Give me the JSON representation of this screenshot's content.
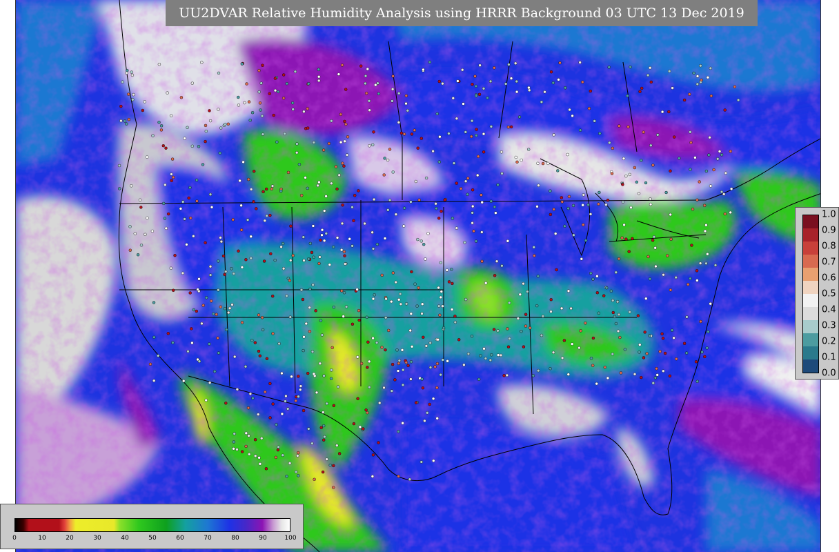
{
  "title": "UU2DVAR Relative Humidity Analysis using HRRR Background 03 UTC 13 Dec 2019",
  "rh_colorbar": {
    "ticks": [
      "0",
      "10",
      "20",
      "30",
      "40",
      "50",
      "60",
      "70",
      "80",
      "90",
      "100"
    ],
    "tick_values": [
      0,
      10,
      20,
      30,
      40,
      50,
      60,
      70,
      80,
      90,
      100
    ],
    "stops": [
      {
        "value": 0,
        "color": "#000000"
      },
      {
        "value": 3,
        "color": "#3a0000"
      },
      {
        "value": 5,
        "color": "#b2101a"
      },
      {
        "value": 16,
        "color": "#b2101a"
      },
      {
        "value": 18,
        "color": "#e0413a"
      },
      {
        "value": 20,
        "color": "#f2a040"
      },
      {
        "value": 22,
        "color": "#eded2a"
      },
      {
        "value": 36,
        "color": "#e8e82a"
      },
      {
        "value": 38,
        "color": "#8ce02a"
      },
      {
        "value": 45,
        "color": "#2fc81e"
      },
      {
        "value": 55,
        "color": "#0ea01e"
      },
      {
        "value": 62,
        "color": "#14a0a0"
      },
      {
        "value": 70,
        "color": "#1e78d2"
      },
      {
        "value": 78,
        "color": "#1e32e6"
      },
      {
        "value": 84,
        "color": "#4628c8"
      },
      {
        "value": 90,
        "color": "#8c14b4"
      },
      {
        "value": 94,
        "color": "#c89bd2"
      },
      {
        "value": 97,
        "color": "#e6e6e6"
      },
      {
        "value": 100,
        "color": "#ffffff"
      }
    ]
  },
  "increment_colorbar": {
    "ticks": [
      "1.0",
      "0.9",
      "0.8",
      "0.7",
      "0.6",
      "0.5",
      "0.4",
      "0.3",
      "0.2",
      "0.1",
      "0.0"
    ],
    "tick_values": [
      1.0,
      0.9,
      0.8,
      0.7,
      0.6,
      0.5,
      0.4,
      0.3,
      0.2,
      0.1,
      0.0
    ],
    "bands": [
      "#7a1020",
      "#a8222a",
      "#c8403a",
      "#d86a50",
      "#e8a070",
      "#f0d4c0",
      "#f2f2f2",
      "#dcdcdc",
      "#a8cccc",
      "#4c9ca0",
      "#2a7a8c",
      "#1e4a7a"
    ]
  },
  "map_colors": {
    "ocean": "#1d33e0",
    "ocean_humid": "#1e78d2",
    "land_moist": "#14a0a0",
    "land_dry": "#2fc81e",
    "land_very_dry": "#e8e82a",
    "clouds_saturated": "#e6e6e6",
    "near_saturated": "#8c14b4",
    "borders": "#000000"
  }
}
